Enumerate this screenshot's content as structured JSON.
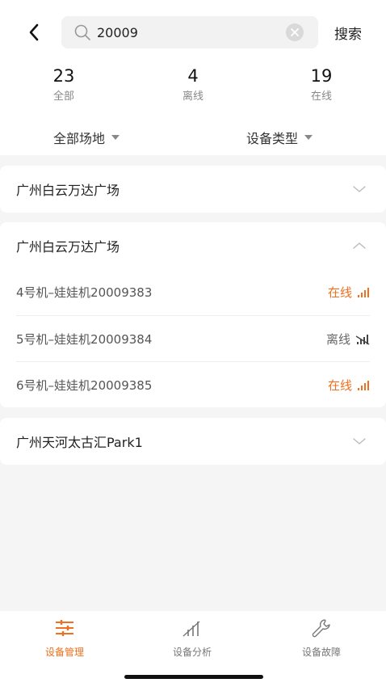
{
  "header": {
    "search_value": "20009",
    "search_button": "搜索"
  },
  "stats": [
    {
      "value": "23",
      "label": "全部"
    },
    {
      "value": "4",
      "label": "离线"
    },
    {
      "value": "19",
      "label": "在线"
    }
  ],
  "filters": {
    "venue": "全部场地",
    "device_type": "设备类型"
  },
  "groups": [
    {
      "title": "广州白云万达广场",
      "expanded": false
    },
    {
      "title": "广州白云万达广场",
      "expanded": true,
      "devices": [
        {
          "name": "4号机–娃娃机20009383",
          "status": "在线",
          "state": "online"
        },
        {
          "name": "5号机–娃娃机20009384",
          "status": "离线",
          "state": "offline"
        },
        {
          "name": "6号机–娃娃机20009385",
          "status": "在线",
          "state": "online"
        }
      ]
    },
    {
      "title": "广州天河太古汇Park1",
      "expanded": false
    }
  ],
  "tabbar": [
    {
      "label": "设备管理",
      "icon": "sliders-icon",
      "active": true
    },
    {
      "label": "设备分析",
      "icon": "chart-icon",
      "active": false
    },
    {
      "label": "设备故障",
      "icon": "wrench-icon",
      "active": false
    }
  ],
  "colors": {
    "accent": "#f0701f",
    "background": "#f5f5f5"
  }
}
